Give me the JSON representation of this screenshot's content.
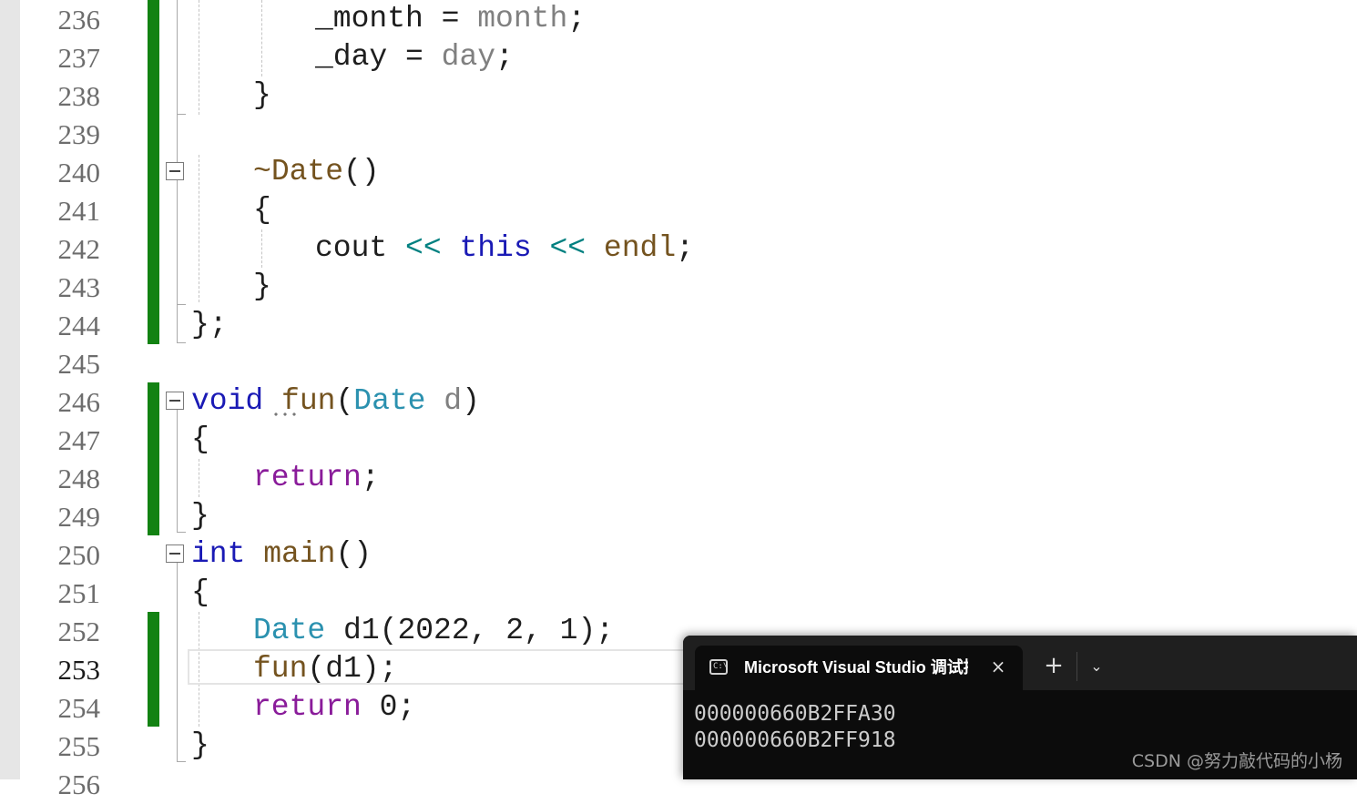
{
  "editor": {
    "line_numbers": [
      "236",
      "237",
      "238",
      "239",
      "240",
      "241",
      "242",
      "243",
      "244",
      "245",
      "246",
      "247",
      "248",
      "249",
      "250",
      "251",
      "252",
      "253",
      "254",
      "255",
      "256"
    ],
    "current_line": "253",
    "code": {
      "l236": {
        "a": "_month",
        "b": " = ",
        "c": "month",
        "d": ";"
      },
      "l237": {
        "a": "_day",
        "b": " = ",
        "c": "day",
        "d": ";"
      },
      "l238": {
        "a": "}"
      },
      "l240": {
        "a": "~",
        "b": "Date",
        "c": "()"
      },
      "l241": {
        "a": "{"
      },
      "l242": {
        "a": "cout ",
        "b": "<<",
        "c": " ",
        "d": "this",
        "e": " ",
        "f": "<<",
        "g": " ",
        "h": "endl",
        "i": ";"
      },
      "l243": {
        "a": "}"
      },
      "l244": {
        "a": "};"
      },
      "l246": {
        "a": "void",
        "b": " ",
        "c": "fun",
        "d": "(",
        "e": "Date",
        "f": " ",
        "g": "d",
        "h": ")"
      },
      "l247": {
        "a": "{"
      },
      "l248": {
        "a": "return",
        "b": ";"
      },
      "l249": {
        "a": "}"
      },
      "l250": {
        "a": "int",
        "b": " ",
        "c": "main",
        "d": "()"
      },
      "l251": {
        "a": "{"
      },
      "l252": {
        "a": "Date",
        "b": " ",
        "c": "d1",
        "d": "(2022, 2, 1);"
      },
      "l253": {
        "a": "fun",
        "b": "(d1);"
      },
      "l254": {
        "a": "return",
        "b": " 0;"
      },
      "l255": {
        "a": "}"
      }
    }
  },
  "terminal": {
    "tab_icon": "C:\\",
    "tab_title": "Microsoft Visual Studio 调试控制台",
    "close_icon": "×",
    "new_tab_icon": "+",
    "dropdown_icon": "⌄",
    "output": [
      "000000660B2FFA30",
      "000000660B2FF918"
    ]
  },
  "watermark": "CSDN @努力敲代码的小杨",
  "colors": {
    "change_bar": "#128212",
    "keyword": "#1a1ab5",
    "control": "#8a1c9a",
    "function": "#74531f",
    "type": "#2b91af",
    "parameter": "#808080",
    "operator": "#008080"
  }
}
